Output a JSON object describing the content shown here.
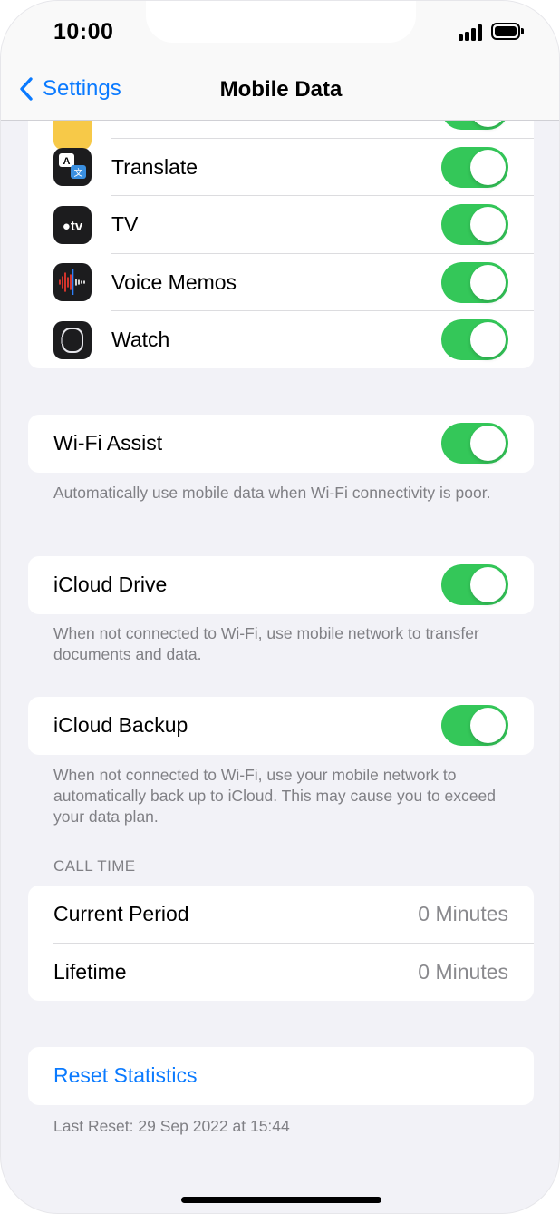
{
  "status_bar": {
    "time": "10:00"
  },
  "nav": {
    "back_label": "Settings",
    "title": "Mobile Data"
  },
  "apps": [
    {
      "label": "Translate",
      "icon": "translate-app-icon",
      "enabled": true
    },
    {
      "label": "TV",
      "icon": "tv-app-icon",
      "enabled": true
    },
    {
      "label": "Voice Memos",
      "icon": "voice-memos-app-icon",
      "enabled": true
    },
    {
      "label": "Watch",
      "icon": "watch-app-icon",
      "enabled": true
    }
  ],
  "wifi_assist": {
    "label": "Wi-Fi Assist",
    "enabled": true,
    "footer": "Automatically use mobile data when Wi-Fi connectivity is poor."
  },
  "icloud_drive": {
    "label": "iCloud Drive",
    "enabled": true,
    "footer": "When not connected to Wi-Fi, use mobile network to transfer documents and data."
  },
  "icloud_backup": {
    "label": "iCloud Backup",
    "enabled": true,
    "footer": "When not connected to Wi-Fi, use your mobile network to automatically back up to iCloud. This may cause you to exceed your data plan."
  },
  "call_time": {
    "header": "CALL TIME",
    "rows": [
      {
        "label": "Current Period",
        "value": "0 Minutes"
      },
      {
        "label": "Lifetime",
        "value": "0 Minutes"
      }
    ]
  },
  "reset": {
    "label": "Reset Statistics",
    "footer": "Last Reset: 29 Sep 2022 at 15:44"
  },
  "colors": {
    "accent": "#0a7aff",
    "toggle_on": "#34c759",
    "background": "#f2f2f7"
  }
}
